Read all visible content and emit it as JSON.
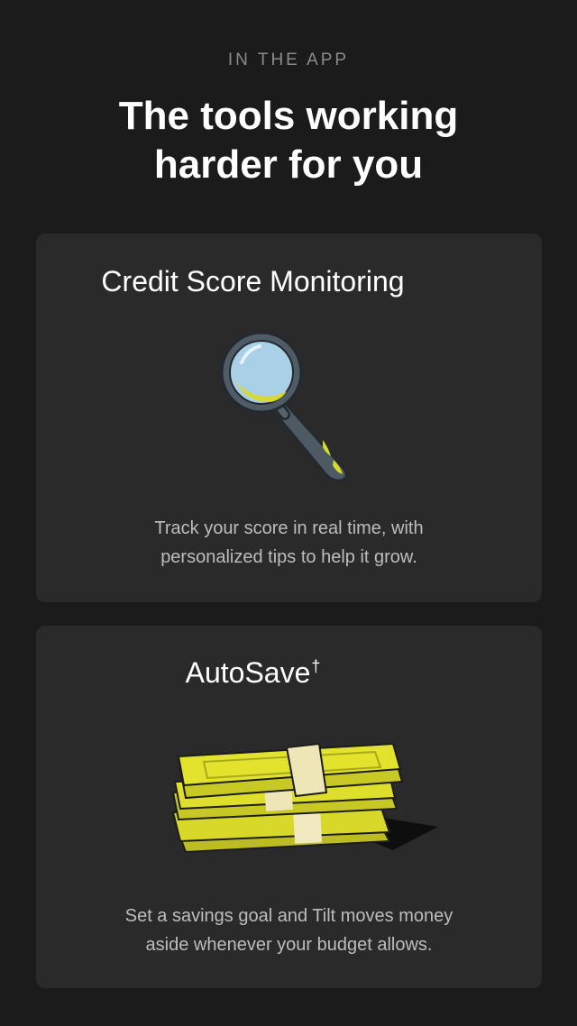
{
  "header": {
    "eyebrow": "IN THE APP",
    "headline_line1": "The tools working",
    "headline_line2": "harder for you"
  },
  "cards": [
    {
      "title": "Credit Score Monitoring",
      "icon": "magnifying-glass-icon",
      "desc_line1": "Track your score in real time, with",
      "desc_line2": "personalized tips to help it grow."
    },
    {
      "title": "AutoSave",
      "title_mark": "†",
      "icon": "money-stack-icon",
      "desc_line1": "Set a savings goal and Tilt moves money",
      "desc_line2": "aside whenever your budget allows."
    }
  ],
  "colors": {
    "background": "#1b1b1b",
    "card": "#2a2a2a",
    "text_primary": "#ffffff",
    "text_muted": "#8a8a8a",
    "text_body": "#bdbdbd",
    "accent_yellow": "#e2e22c",
    "lens_blue": "#a9cfe6",
    "handle_slate": "#4d5a64"
  }
}
